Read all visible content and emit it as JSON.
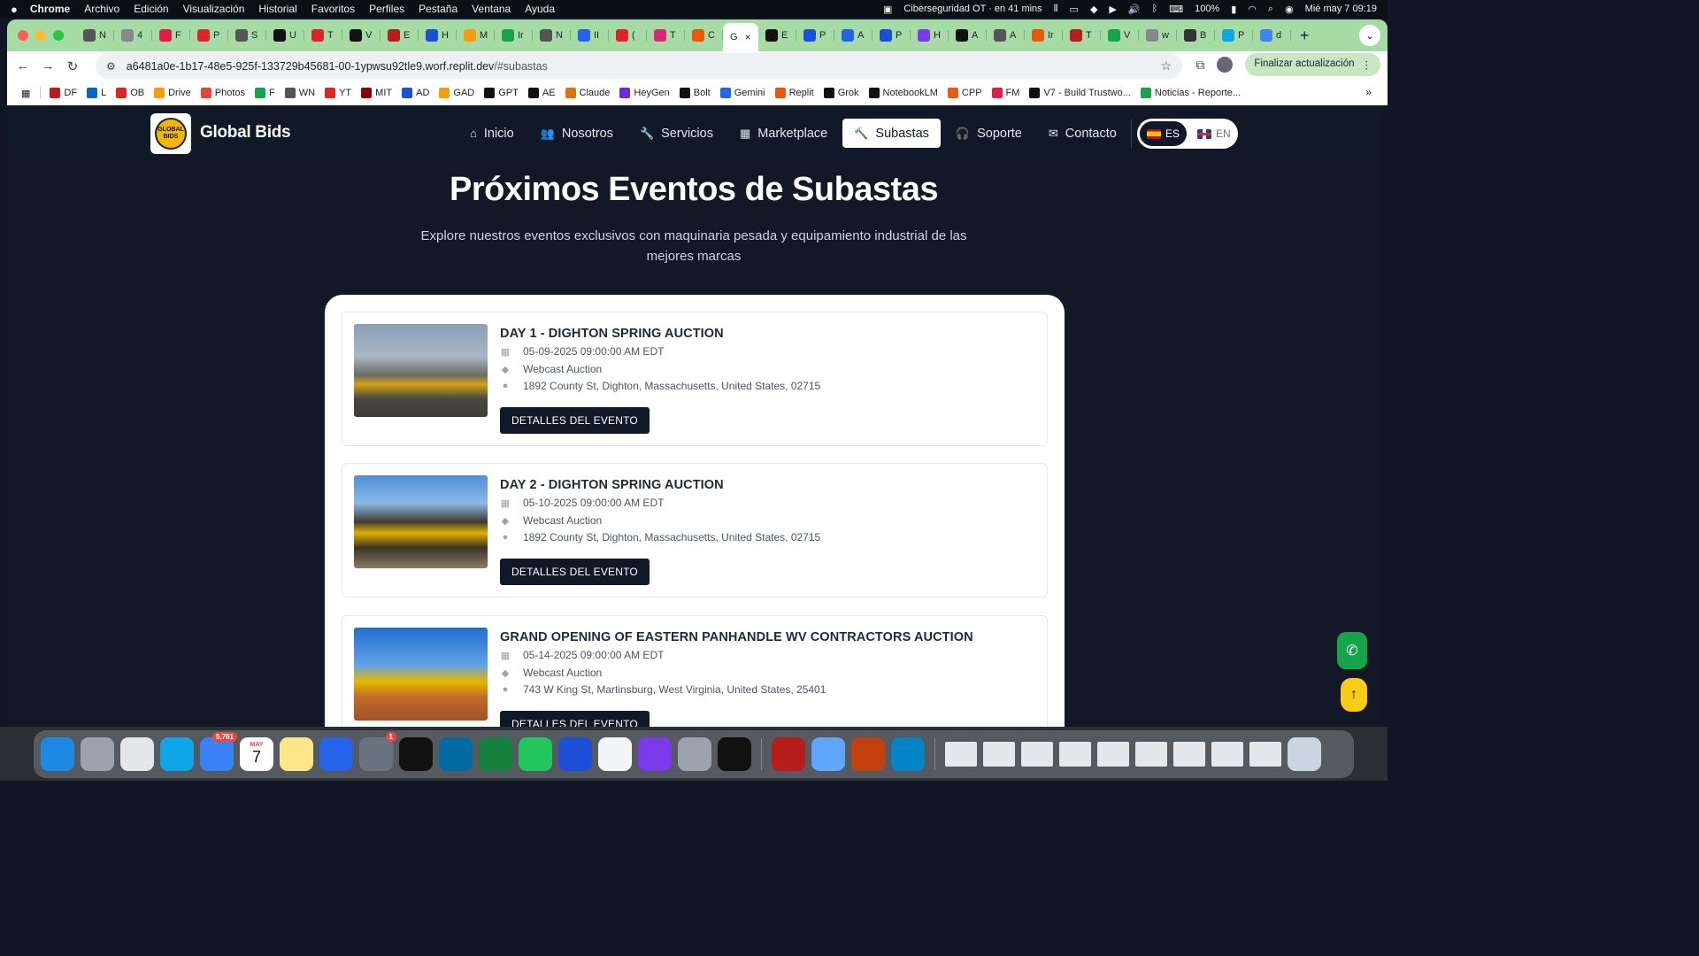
{
  "menubar": {
    "app": "Chrome",
    "items": [
      "Archivo",
      "Edición",
      "Visualización",
      "Historial",
      "Favoritos",
      "Perfiles",
      "Pestaña",
      "Ventana",
      "Ayuda"
    ],
    "event": "Ciberseguridad OT · en 41 mins",
    "battery": "100%",
    "datetime": "Mié may 7  09:19"
  },
  "tabs": [
    {
      "label": "N",
      "color": "#555"
    },
    {
      "label": "4",
      "color": "#888"
    },
    {
      "label": "F",
      "color": "#e11d48"
    },
    {
      "label": "P",
      "color": "#dc2626"
    },
    {
      "label": "S",
      "color": "#555"
    },
    {
      "label": "U",
      "color": "#111"
    },
    {
      "label": "T",
      "color": "#dc2626"
    },
    {
      "label": "V",
      "color": "#111"
    },
    {
      "label": "E",
      "color": "#b91c1c"
    },
    {
      "label": "H",
      "color": "#1d4ed8"
    },
    {
      "label": "M",
      "color": "#f59e0b"
    },
    {
      "label": "Ir",
      "color": "#16a34a"
    },
    {
      "label": "N",
      "color": "#555"
    },
    {
      "label": "II",
      "color": "#2563eb"
    },
    {
      "label": "(",
      "color": "#dc2626"
    },
    {
      "label": "T",
      "color": "#db2777"
    },
    {
      "label": "C",
      "color": "#ea580c"
    }
  ],
  "active_tab": {
    "label": "G",
    "close": "×"
  },
  "tabs_right": [
    {
      "label": "E",
      "color": "#111"
    },
    {
      "label": "P",
      "color": "#1d4ed8"
    },
    {
      "label": "A",
      "color": "#2563eb"
    },
    {
      "label": "P",
      "color": "#1d4ed8"
    },
    {
      "label": "H",
      "color": "#7c3aed"
    },
    {
      "label": "A",
      "color": "#111"
    },
    {
      "label": "A",
      "color": "#555"
    },
    {
      "label": "Ir",
      "color": "#ea580c"
    },
    {
      "label": "T",
      "color": "#b91c1c"
    },
    {
      "label": "V",
      "color": "#16a34a"
    },
    {
      "label": "w",
      "color": "#888"
    },
    {
      "label": "B",
      "color": "#333"
    },
    {
      "label": "P",
      "color": "#0ea5e9"
    },
    {
      "label": "d",
      "color": "#4285f4"
    }
  ],
  "new_tab": "+",
  "url": {
    "host": "a6481a0e-1b17-48e5-925f-133729b45681-00-1ypwsu92tle9.worf.replit.dev",
    "path": "/#subastas"
  },
  "update_button": "Finalizar actualización",
  "bookmarks": [
    {
      "label": "DF",
      "color": "#b91c1c"
    },
    {
      "label": "L",
      "color": "#0a66c2"
    },
    {
      "label": "OB",
      "color": "#dc2626"
    },
    {
      "label": "Drive",
      "color": "#f59e0b"
    },
    {
      "label": "Photos",
      "color": "#ea4335"
    },
    {
      "label": "F",
      "color": "#16a34a"
    },
    {
      "label": "WN",
      "color": "#555"
    },
    {
      "label": "YT",
      "color": "#dc2626"
    },
    {
      "label": "MIT",
      "color": "#8b0000"
    },
    {
      "label": "AD",
      "color": "#1d4ed8"
    },
    {
      "label": "GAD",
      "color": "#f59e0b"
    },
    {
      "label": "GPT",
      "color": "#111"
    },
    {
      "label": "AE",
      "color": "#111"
    },
    {
      "label": "Claude",
      "color": "#d97706"
    },
    {
      "label": "HeyGen",
      "color": "#6d28d9"
    },
    {
      "label": "Bolt",
      "color": "#111"
    },
    {
      "label": "Gemini",
      "color": "#2563eb"
    },
    {
      "label": "Replit",
      "color": "#ea580c"
    },
    {
      "label": "Grok",
      "color": "#111"
    },
    {
      "label": "NotebookLM",
      "color": "#111"
    },
    {
      "label": "CPP",
      "color": "#ea580c"
    },
    {
      "label": "FM",
      "color": "#e11d48"
    },
    {
      "label": "V7 - Build Trustwo...",
      "color": "#111"
    },
    {
      "label": "Noticias - Reporte...",
      "color": "#16a34a"
    }
  ],
  "site": {
    "brand": "Global Bids",
    "logo_text": "GLOBAL BIDS",
    "nav": [
      {
        "label": "Inicio",
        "icon": "home-icon",
        "glyph": "⌂"
      },
      {
        "label": "Nosotros",
        "icon": "users-icon",
        "glyph": "👥"
      },
      {
        "label": "Servicios",
        "icon": "wrench-icon",
        "glyph": "🔧"
      },
      {
        "label": "Marketplace",
        "icon": "grid-icon",
        "glyph": "▦"
      },
      {
        "label": "Subastas",
        "icon": "gavel-icon",
        "glyph": "🔨"
      },
      {
        "label": "Soporte",
        "icon": "headset-icon",
        "glyph": "🎧"
      },
      {
        "label": "Contacto",
        "icon": "envelope-icon",
        "glyph": "✉"
      }
    ],
    "active_nav": "Subastas",
    "lang": {
      "es": "ES",
      "en": "EN",
      "active": "ES"
    },
    "heading": "Próximos Eventos de Subastas",
    "subheading": "Explore nuestros eventos exclusivos con maquinaria pesada y equipamiento industrial de las mejores marcas",
    "events": [
      {
        "title": "DAY 1 - DIGHTON SPRING AUCTION",
        "date": "05-09-2025 09:00:00 AM EDT",
        "type": "Webcast Auction",
        "location": "1892 County St, Dighton, Massachusetts, United States, 02715",
        "button": "DETALLES DEL EVENTO"
      },
      {
        "title": "DAY 2 - DIGHTON SPRING AUCTION",
        "date": "05-10-2025 09:00:00 AM EDT",
        "type": "Webcast Auction",
        "location": "1892 County St, Dighton, Massachusetts, United States, 02715",
        "button": "DETALLES DEL EVENTO"
      },
      {
        "title": "GRAND OPENING OF EASTERN PANHANDLE WV CONTRACTORS AUCTION",
        "date": "05-14-2025 09:00:00 AM EDT",
        "type": "Webcast Auction",
        "location": "743 W King St, Martinsburg, West Virginia, United States, 25401",
        "button": "DETALLES DEL EVENTO"
      }
    ]
  },
  "dock": {
    "mail_badge": "5,761",
    "calendar_month": "MAY",
    "calendar_day": "7",
    "settings_badge": "1",
    "apps": [
      {
        "name": "finder",
        "color": "#1e88e5"
      },
      {
        "name": "launchpad",
        "color": "#9ca3af"
      },
      {
        "name": "chrome",
        "color": "#e5e7eb"
      },
      {
        "name": "safari",
        "color": "#0ea5e9"
      },
      {
        "name": "mail",
        "color": "#3b82f6"
      },
      {
        "name": "calendar",
        "color": "#ffffff"
      },
      {
        "name": "notes",
        "color": "#fde68a"
      },
      {
        "name": "keynote",
        "color": "#2563eb"
      },
      {
        "name": "system-settings",
        "color": "#6b7280"
      },
      {
        "name": "spotify",
        "color": "#111111"
      },
      {
        "name": "outlook",
        "color": "#0369a1"
      },
      {
        "name": "excel",
        "color": "#15803d"
      },
      {
        "name": "whatsapp",
        "color": "#22c55e"
      },
      {
        "name": "word",
        "color": "#1d4ed8"
      },
      {
        "name": "7-day",
        "color": "#f3f4f6"
      },
      {
        "name": "omnifocus",
        "color": "#7c3aed"
      },
      {
        "name": "pencil",
        "color": "#9ca3af"
      },
      {
        "name": "blocks",
        "color": "#111111"
      },
      {
        "name": "acrobat",
        "color": "#b91c1c"
      },
      {
        "name": "preview",
        "color": "#60a5fa"
      },
      {
        "name": "powerpoint",
        "color": "#c2410c"
      },
      {
        "name": "vscode",
        "color": "#0284c7"
      }
    ]
  }
}
